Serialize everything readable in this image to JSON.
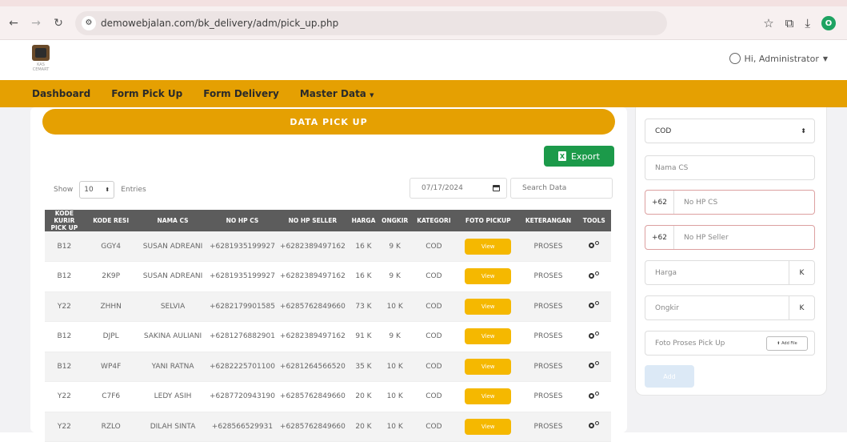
{
  "browser": {
    "url": "demowebjalan.com/bk_delivery/adm/pick_up.php",
    "profile_initial": "O"
  },
  "header": {
    "logo_text": "KAS CEMART",
    "user_label": "Hi, Administrator"
  },
  "navbar": {
    "items": [
      "Dashboard",
      "Form Pick Up",
      "Form Delivery",
      "Master Data"
    ]
  },
  "main": {
    "title": "DATA PICK UP",
    "export_label": "Export",
    "show_label": "Show",
    "entries_value": "10",
    "entries_label": "Entries",
    "date_value": "07/17/2024",
    "search_placeholder": "Search Data",
    "table": {
      "headers": [
        "KODE KURIR PICK UP",
        "KODE RESI",
        "NAMA CS",
        "NO HP CS",
        "NO HP SELLER",
        "HARGA",
        "ONGKIR",
        "KATEGORI",
        "FOTO PICKUP",
        "KETERANGAN",
        "TOOLS"
      ],
      "view_label": "View",
      "rows": [
        [
          "B12",
          "GGY4",
          "SUSAN ADREANI",
          "+6281935199927",
          "+6282389497162",
          "16 K",
          "9 K",
          "COD",
          "PROSES"
        ],
        [
          "B12",
          "2K9P",
          "SUSAN ADREANI",
          "+6281935199927",
          "+6282389497162",
          "16 K",
          "9 K",
          "COD",
          "PROSES"
        ],
        [
          "Y22",
          "ZHHN",
          "SELVIA",
          "+6282179901585",
          "+6285762849660",
          "73 K",
          "10 K",
          "COD",
          "PROSES"
        ],
        [
          "B12",
          "DJPL",
          "SAKINA AULIANI",
          "+6281276882901",
          "+6282389497162",
          "91 K",
          "9 K",
          "COD",
          "PROSES"
        ],
        [
          "B12",
          "WP4F",
          "YANI RATNA",
          "+6282225701100",
          "+6281264566520",
          "35 K",
          "10 K",
          "COD",
          "PROSES"
        ],
        [
          "Y22",
          "C7F6",
          "LEDY ASIH",
          "+6287720943190",
          "+6285762849660",
          "20 K",
          "10 K",
          "COD",
          "PROSES"
        ],
        [
          "Y22",
          "RZLO",
          "DILAH SINTA",
          "+628566529931",
          "+6285762849660",
          "20 K",
          "10 K",
          "COD",
          "PROSES"
        ]
      ]
    }
  },
  "side_form": {
    "kategori_value": "COD",
    "nama_cs_placeholder": "Nama CS",
    "phone_prefix": "+62",
    "no_hp_cs_placeholder": "No HP CS",
    "no_hp_seller_placeholder": "No HP Seller",
    "harga_placeholder": "Harga",
    "ongkir_placeholder": "Ongkir",
    "currency_suffix": "K",
    "foto_placeholder": "Foto Proses Pick Up",
    "choose_file_label": "Add File",
    "save_label": "Add"
  }
}
